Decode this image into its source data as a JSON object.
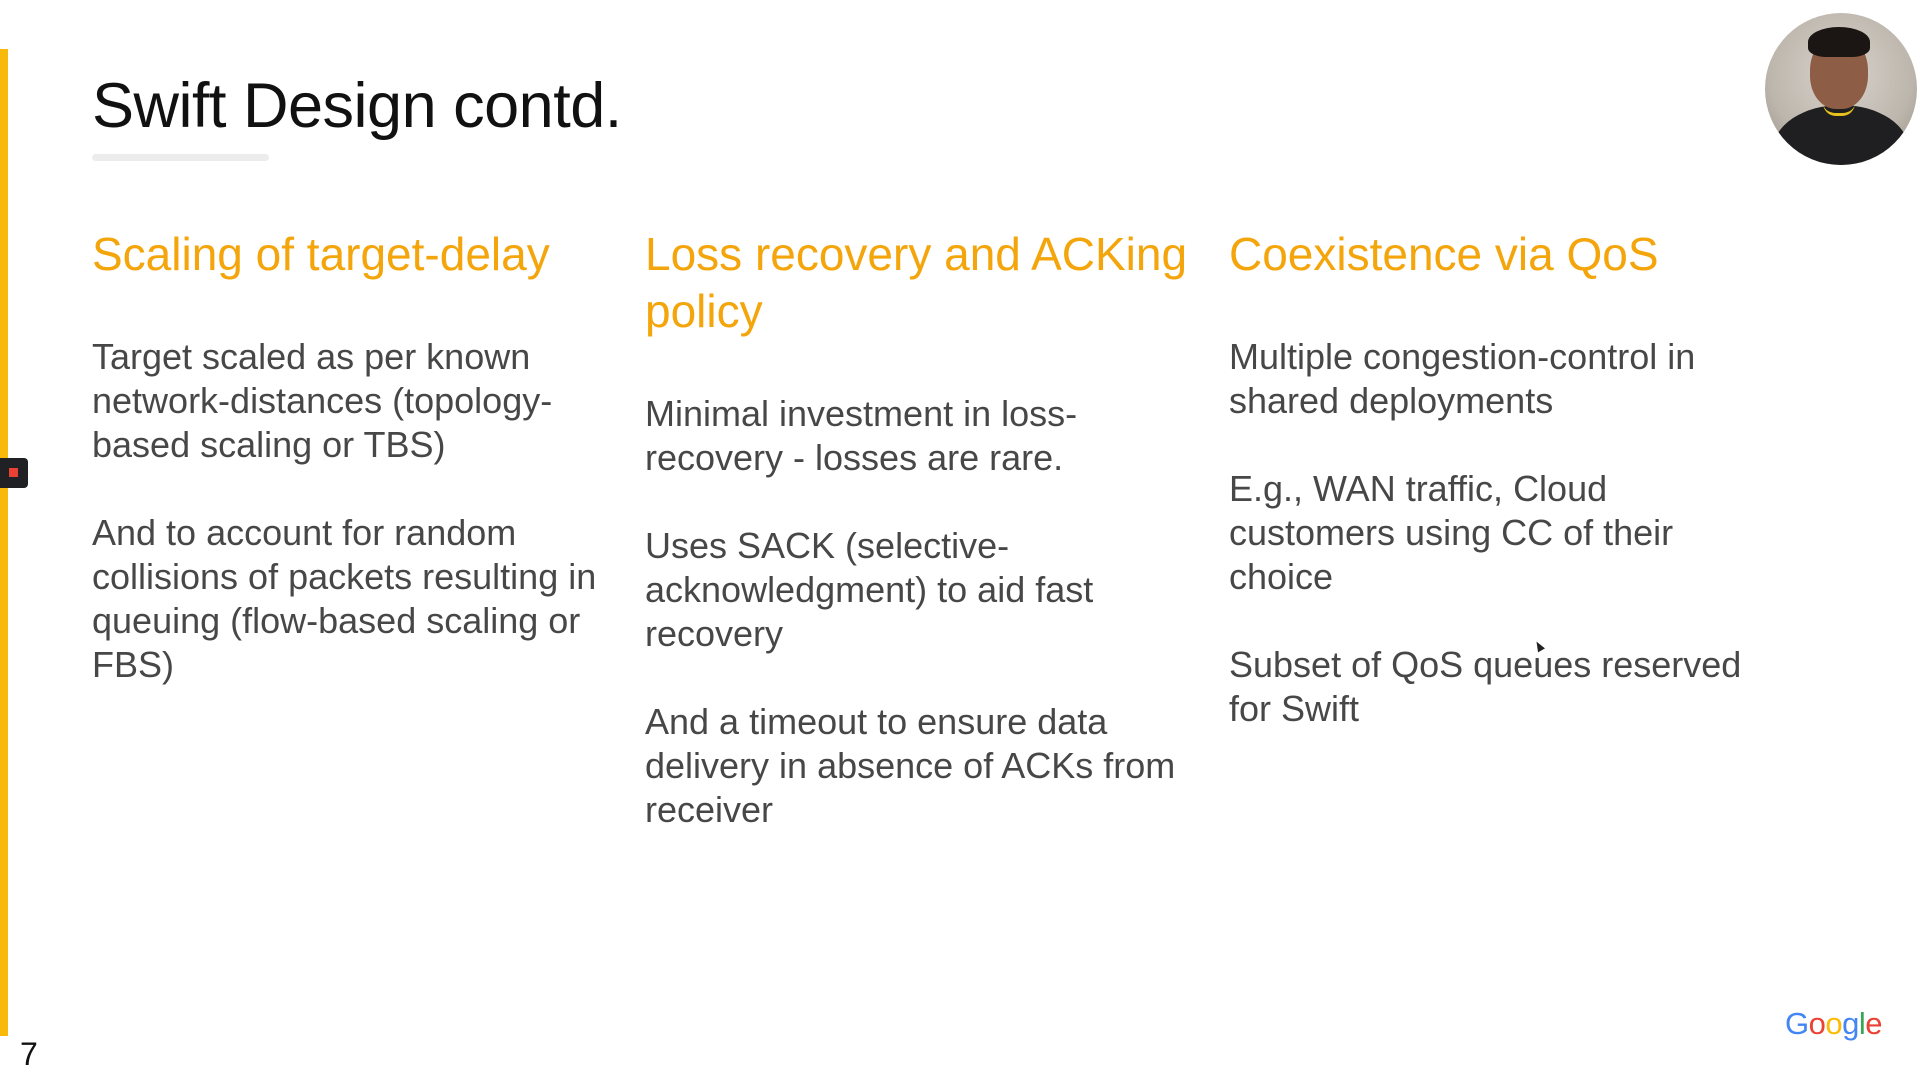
{
  "slide": {
    "title": "Swift Design contd.",
    "page_number": "7",
    "logo_text": [
      "G",
      "o",
      "o",
      "g",
      "l",
      "e"
    ]
  },
  "columns": [
    {
      "heading": "Scaling of target-delay",
      "paragraphs": [
        "Target scaled as per known network-distances (topology-based scaling or TBS)",
        "And to account for random collisions of packets resulting in queuing (flow-based scaling or FBS)"
      ]
    },
    {
      "heading": "Loss recovery and ACKing policy",
      "paragraphs": [
        "Minimal investment in loss-recovery - losses are rare.",
        "Uses SACK (selective-acknowledgment) to aid fast recovery",
        "And a timeout to ensure data delivery in absence of ACKs from receiver"
      ]
    },
    {
      "heading": "Coexistence via QoS",
      "paragraphs": [
        "Multiple congestion-control in shared deployments",
        "E.g., WAN traffic, Cloud customers using CC of their choice",
        "Subset of QoS queues reserved for Swift"
      ]
    }
  ],
  "colors": {
    "accent_bar": "#f9b90a",
    "heading": "#f4a50b",
    "body_text": "#474747",
    "title_text": "#111111"
  },
  "icons": {
    "webcam": "presenter-webcam-icon",
    "marker": "slide-marker-icon",
    "cursor": "mouse-cursor-icon"
  }
}
